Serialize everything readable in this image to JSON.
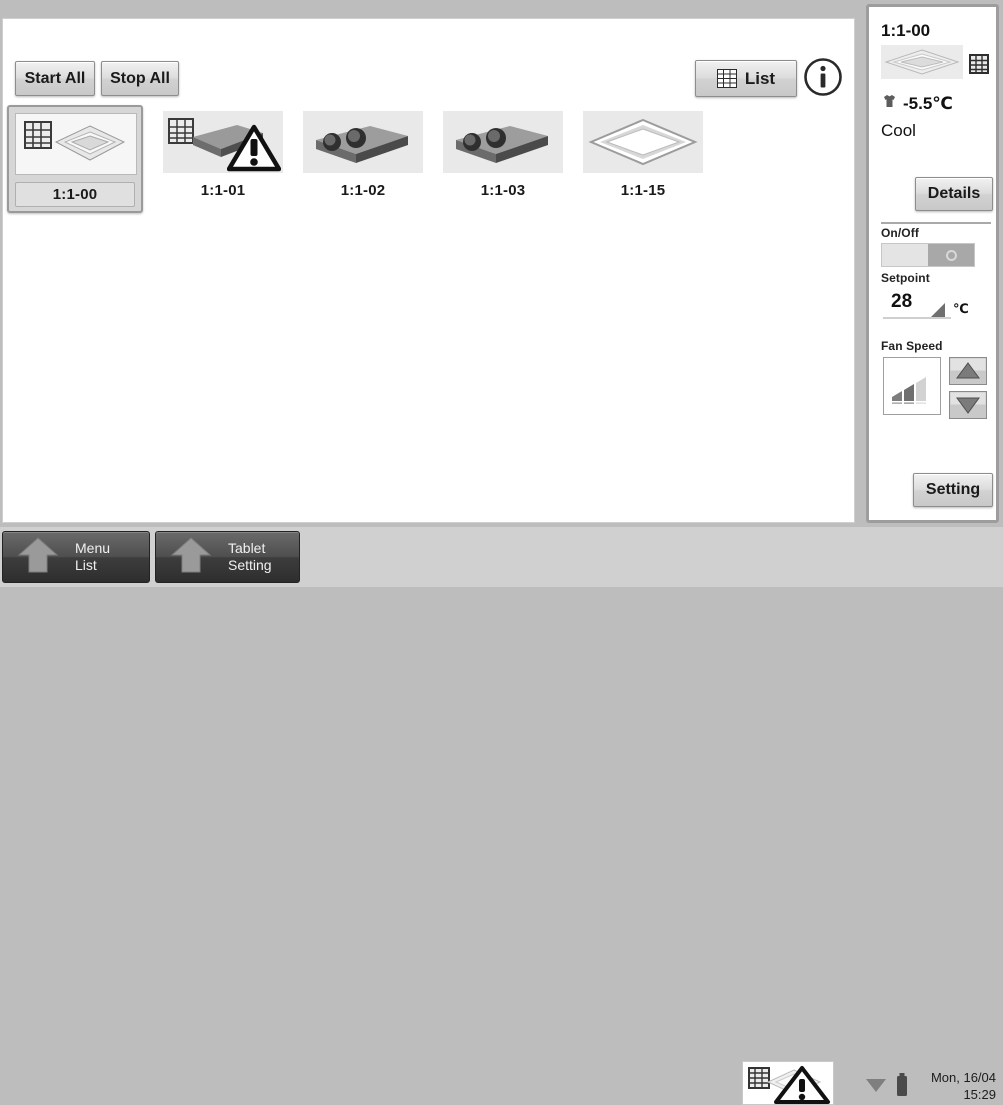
{
  "toolbar": {
    "start_all": "Start All",
    "stop_all": "Stop All",
    "list": "List",
    "list_icon": "table-grid-icon",
    "info_icon": "info-circle-icon"
  },
  "devices": [
    {
      "id": "1:1-00",
      "type": "ceiling-cassette",
      "selected": true,
      "alarm": false
    },
    {
      "id": "1:1-01",
      "type": "duct-unit",
      "selected": false,
      "alarm": true
    },
    {
      "id": "1:1-02",
      "type": "duct-unit",
      "selected": false,
      "alarm": false
    },
    {
      "id": "1:1-03",
      "type": "duct-unit",
      "selected": false,
      "alarm": false
    },
    {
      "id": "1:1-15",
      "type": "ceiling-panel",
      "selected": false,
      "alarm": false
    }
  ],
  "side_panel": {
    "title": "1:1-00",
    "unit_icon": "ceiling-cassette-icon",
    "remote_icon": "controller-grid-icon",
    "temp_icon": "room-temperature-icon",
    "temperature": "-5.5℃",
    "mode": "Cool",
    "details_label": "Details",
    "onoff_label": "On/Off",
    "onoff_state": "off",
    "setpoint_label": "Setpoint",
    "setpoint_value": "28",
    "setpoint_unit": "℃",
    "fan_label": "Fan Speed",
    "fan_level": 2,
    "fan_levels_total": 3,
    "fan_up_icon": "arrow-up-icon",
    "fan_down_icon": "arrow-down-icon",
    "setting_label": "Setting"
  },
  "bottom_bar": {
    "menu_list_line1": "Menu",
    "menu_list_line2": "List",
    "tablet_setting_line1": "Tablet",
    "tablet_setting_line2": "Setting",
    "alert_icon": "unit-alarm-icon",
    "wifi_icon": "wifi-icon",
    "battery_icon": "battery-icon",
    "date": "Mon, 16/04",
    "time": "15:29"
  },
  "colors": {
    "frame": "#bdbdbd",
    "panel": "#ffffff",
    "bottom_bar": "#d0d0d0",
    "selected_tile": "#d6d6d6",
    "toggle_off": "#a8a8a8"
  }
}
